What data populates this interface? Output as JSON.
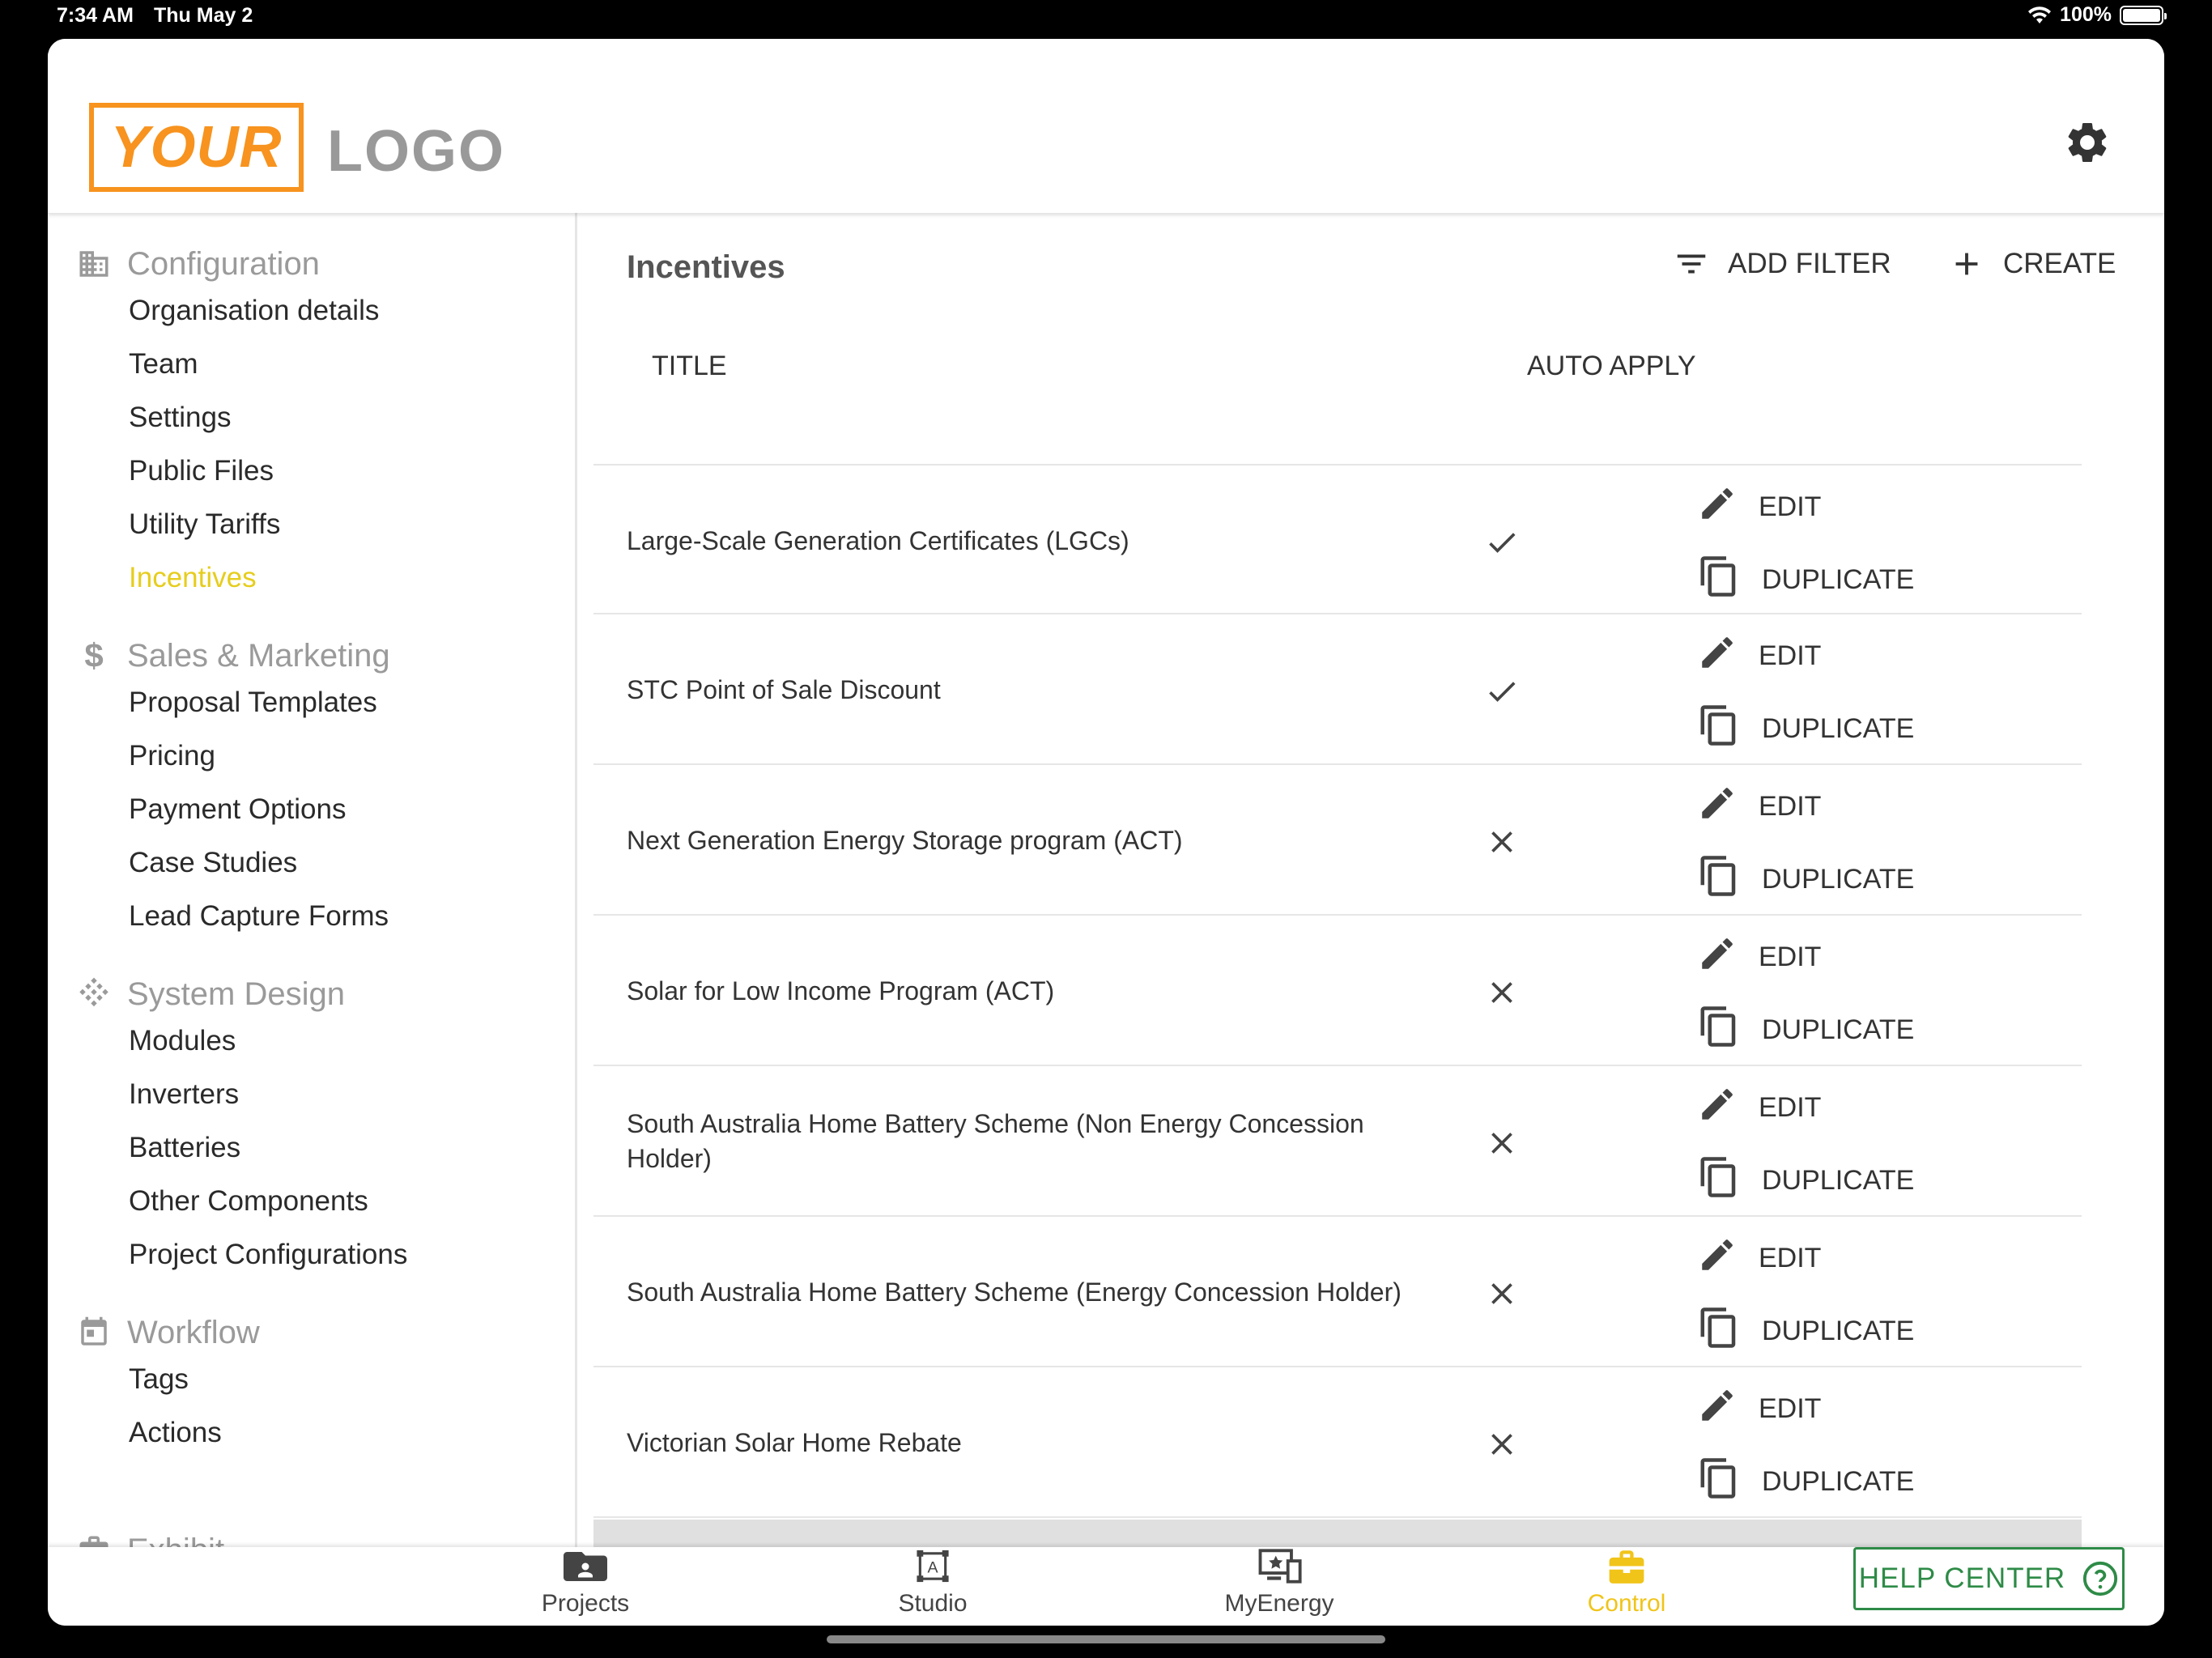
{
  "status_bar": {
    "time": "7:34 AM",
    "date": "Thu May 2",
    "battery": "100%"
  },
  "header": {
    "logo_box_text": "YOUR",
    "logo_text": "LOGO"
  },
  "sidebar": {
    "sections": [
      {
        "title": "Configuration",
        "icon": "building-icon",
        "items": [
          "Organisation details",
          "Team",
          "Settings",
          "Public Files",
          "Utility Tariffs",
          "Incentives"
        ]
      },
      {
        "title": "Sales & Marketing",
        "icon": "dollar-icon",
        "items": [
          "Proposal Templates",
          "Pricing",
          "Payment Options",
          "Case Studies",
          "Lead Capture Forms"
        ]
      },
      {
        "title": "System Design",
        "icon": "solar-grid-icon",
        "items": [
          "Modules",
          "Inverters",
          "Batteries",
          "Other Components",
          "Project Configurations"
        ]
      },
      {
        "title": "Workflow",
        "icon": "calendar-icon",
        "items": [
          "Tags",
          "Actions"
        ]
      },
      {
        "title": "Exhibit",
        "icon": "briefcase-icon",
        "items": []
      }
    ],
    "active_item": "Incentives"
  },
  "main": {
    "title": "Incentives",
    "add_filter_label": "ADD FILTER",
    "create_label": "CREATE",
    "columns": {
      "title": "TITLE",
      "auto_apply": "AUTO APPLY"
    },
    "edit_label": "EDIT",
    "duplicate_label": "DUPLICATE",
    "rows": [
      {
        "title": "Large-Scale Generation Certificates (LGCs)",
        "auto_apply": true
      },
      {
        "title": "STC Point of Sale Discount",
        "auto_apply": true
      },
      {
        "title": "Next Generation Energy Storage program (ACT)",
        "auto_apply": false
      },
      {
        "title": "Solar for Low Income Program (ACT)",
        "auto_apply": false
      },
      {
        "title": "South Australia Home Battery Scheme (Non Energy Concession Holder)",
        "auto_apply": false
      },
      {
        "title": "South Australia Home Battery Scheme (Energy Concession Holder)",
        "auto_apply": false
      },
      {
        "title": "Victorian Solar Home Rebate",
        "auto_apply": false
      }
    ]
  },
  "bottom_nav": {
    "tabs": [
      {
        "label": "Projects",
        "icon": "folder-person-icon"
      },
      {
        "label": "Studio",
        "icon": "studio-frame-icon"
      },
      {
        "label": "MyEnergy",
        "icon": "devices-star-icon"
      },
      {
        "label": "Control",
        "icon": "toolbox-icon"
      }
    ],
    "active_tab": "Control",
    "help_center_label": "HELP CENTER"
  },
  "colors": {
    "logo_orange": "#f7931e",
    "active_yellow": "#e6cd1d",
    "control_yellow": "#f0c419",
    "help_green": "#2e8b47"
  }
}
